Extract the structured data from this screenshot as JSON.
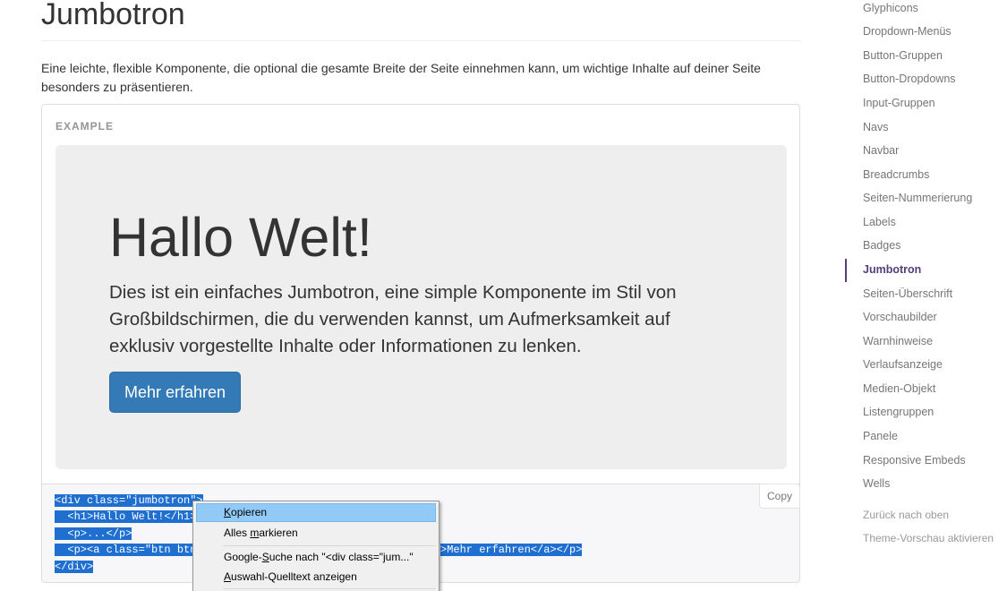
{
  "main": {
    "title": "Jumbotron",
    "intro": "Eine leichte, flexible Komponente, die optional die gesamte Breite der Seite einnehmen kann, um wichtige Inhalte auf deiner Seite besonders zu präsentieren.",
    "example_label": "EXAMPLE",
    "jumbotron": {
      "heading": "Hallo Welt!",
      "text": "Dies ist ein einfaches Jumbotron, eine simple Komponente im Stil von Großbildschirmen, die du verwenden kannst, um Aufmerksamkeit auf exklusiv vorgestellte Inhalte oder Informationen zu lenken.",
      "button_label": "Mehr erfahren"
    },
    "code": {
      "copy_label": "Copy",
      "line1": "<div class=\"jumbotron\">",
      "line2": "  <h1>Hallo Welt!</h1>",
      "line3": "  <p>...</p>",
      "line4a": "  <p><a class=\"btn btn",
      "line4b": ">Mehr erfahren</a></p>",
      "line5": "</div>"
    }
  },
  "context_menu": {
    "items": [
      {
        "label": "Kopieren",
        "accesskey": "K",
        "rest": "opieren"
      },
      {
        "label": "Alles markieren",
        "pre": "Alles ",
        "accesskey": "m",
        "rest": "arkieren"
      },
      {
        "label": "Google-Suche nach \"<div class=\"jum...\"",
        "pre": "Google-",
        "accesskey": "S",
        "rest": "uche nach \"<div class=\"jum...\""
      },
      {
        "label": "Auswahl-Quelltext anzeigen",
        "accesskey": "A",
        "rest": "uswahl-Quelltext anzeigen"
      }
    ]
  },
  "sidenav": {
    "items": [
      "Glyphicons",
      "Dropdown-Menüs",
      "Button-Gruppen",
      "Button-Dropdowns",
      "Input-Gruppen",
      "Navs",
      "Navbar",
      "Breadcrumbs",
      "Seiten-Nummerierung",
      "Labels",
      "Badges",
      "Jumbotron",
      "Seiten-Überschrift",
      "Vorschaubilder",
      "Warnhinweise",
      "Verlaufsanzeige",
      "Medien-Objekt",
      "Listengruppen",
      "Panele",
      "Responsive Embeds",
      "Wells"
    ],
    "active": "Jumbotron",
    "back_to_top": "Zurück nach oben",
    "theme_preview": "Theme-Vorschau aktivieren"
  },
  "colors": {
    "primary_button": "#337ab7",
    "active_nav": "#563d7c",
    "selection": "#1e6fd0",
    "menu_hover": "#91c9f7"
  }
}
